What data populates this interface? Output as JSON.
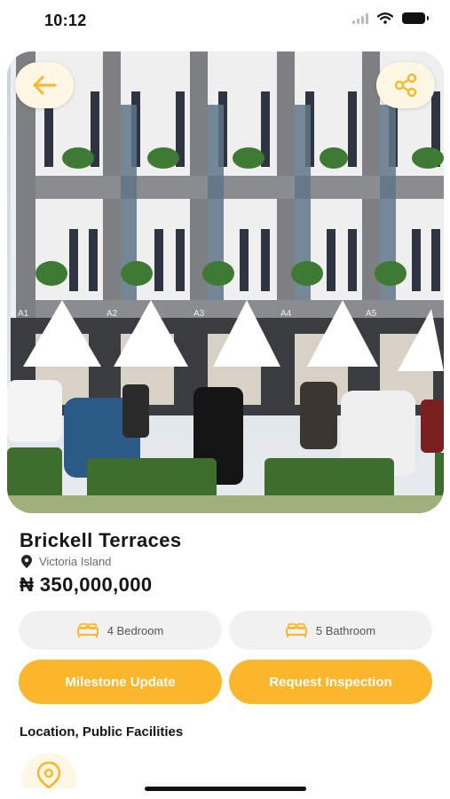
{
  "status_bar": {
    "time": "10:12",
    "icons": [
      "cellular-icon",
      "wifi-icon",
      "battery-icon"
    ]
  },
  "hero": {
    "image_subject": "townhouse-terrace-photo",
    "unit_labels": [
      "A1",
      "A2",
      "A3",
      "A4",
      "A5"
    ],
    "back_icon": "arrow-left-icon",
    "share_icon": "share-icon"
  },
  "property": {
    "name": "Brickell Terraces",
    "location": "Victoria Island",
    "price": "₦ 350,000,000"
  },
  "features": {
    "bedroom_label": "4 Bedroom",
    "bathroom_label": "5 Bathroom"
  },
  "actions": {
    "milestone_label": "Milestone Update",
    "inspection_label": "Request Inspection"
  },
  "section": {
    "facilities_heading": "Location, Public Facilities"
  },
  "colors": {
    "accent": "#fbb62b",
    "accent_light": "#fdf7e4",
    "pill_bg": "#f1f1f1",
    "text_dark": "#151515",
    "text_muted": "#6b6b6b"
  }
}
